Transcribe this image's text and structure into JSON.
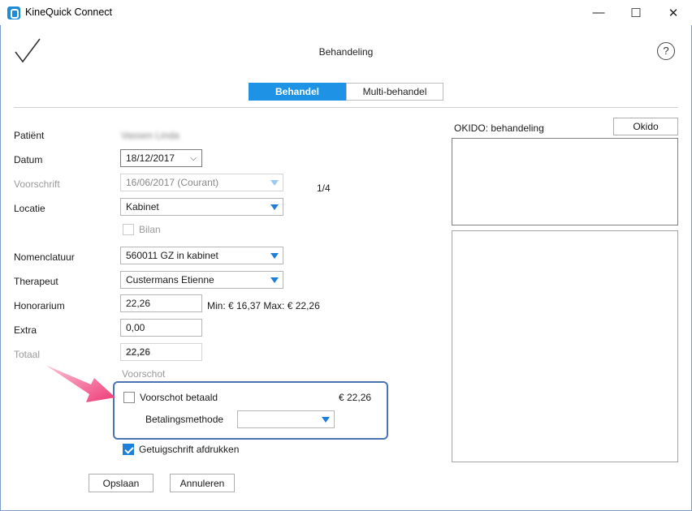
{
  "window": {
    "title": "KineQuick Connect",
    "minimize_glyph": "—",
    "maximize_glyph": "☐",
    "close_glyph": "✕"
  },
  "header": {
    "title": "Behandeling",
    "help_glyph": "?"
  },
  "tabs": [
    {
      "label": "Behandel",
      "active": true
    },
    {
      "label": "Multi-behandel",
      "active": false
    }
  ],
  "form": {
    "patient_label": "Patiënt",
    "patient_value": "Vassen Linda",
    "datum_label": "Datum",
    "datum_value": "18/12/2017",
    "voorschrift_label": "Voorschrift",
    "voorschrift_value": "16/06/2017 (Courant)",
    "voorschrift_count": "1/4",
    "locatie_label": "Locatie",
    "locatie_value": "Kabinet",
    "bilan_label": "Bilan",
    "nomenclatuur_label": "Nomenclatuur",
    "nomenclatuur_value": "560011 GZ in kabinet",
    "therapeut_label": "Therapeut",
    "therapeut_value": "Custermans Etienne",
    "honorarium_label": "Honorarium",
    "honorarium_value": "22,26",
    "honorarium_range": "Min: € 16,37 Max: € 22,26",
    "extra_label": "Extra",
    "extra_value": "0,00",
    "totaal_label": "Totaal",
    "totaal_value": "22,26",
    "voorschot_label": "Voorschot",
    "voorschot_betaald_label": "Voorschot betaald",
    "voorschot_amount": "€ 22,26",
    "betalingsmethode_label": "Betalingsmethode",
    "betalingsmethode_value": "",
    "getuigschrift_label": "Getuigschrift afdrukken"
  },
  "buttons": {
    "save": "Opslaan",
    "cancel": "Annuleren",
    "okido": "Okido"
  },
  "okido": {
    "title": "OKIDO: behandeling"
  },
  "colors": {
    "accent": "#1e93e6",
    "highlight_border": "#4a74b4",
    "arrow": "#f0447a"
  }
}
